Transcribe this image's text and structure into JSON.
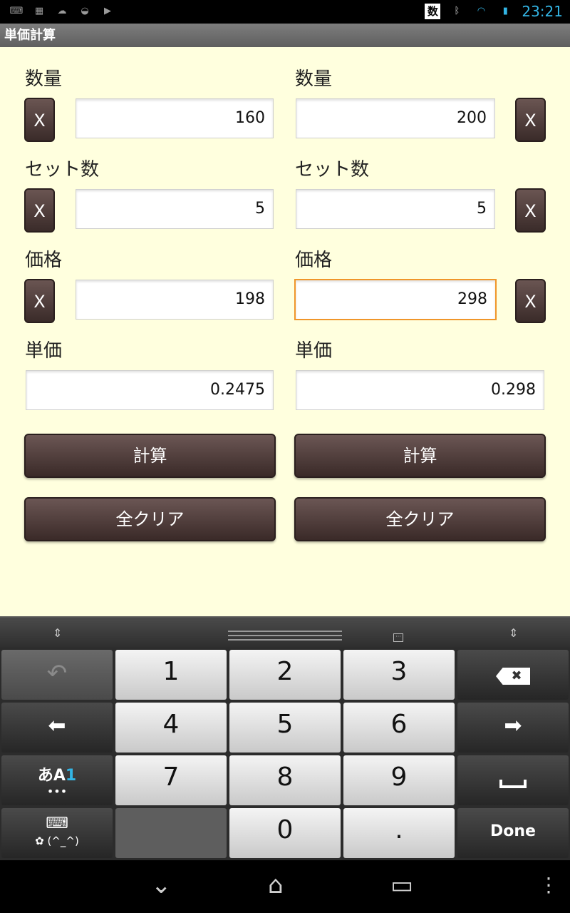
{
  "status_bar": {
    "left_icons": [
      "keyboard-icon",
      "photo-icon",
      "weather-icon",
      "android-icon",
      "play-store-icon"
    ],
    "ime_indicator": "数",
    "time": "23:21",
    "icons": [
      "bluetooth-icon",
      "wifi-icon",
      "battery-icon"
    ]
  },
  "app": {
    "title": "単価計算"
  },
  "left": {
    "quantity_label": "数量",
    "quantity_value": "160",
    "set_label": "セット数",
    "set_value": "5",
    "price_label": "価格",
    "price_value": "198",
    "unit_price_label": "単価",
    "unit_price_value": "0.2475",
    "clear_x": "X",
    "calc_label": "計算",
    "clear_all_label": "全クリア"
  },
  "right": {
    "quantity_label": "数量",
    "quantity_value": "200",
    "set_label": "セット数",
    "set_value": "5",
    "price_label": "価格",
    "price_value": "298",
    "unit_price_label": "単価",
    "unit_price_value": "0.298",
    "clear_x": "X",
    "calc_label": "計算",
    "clear_all_label": "全クリア"
  },
  "keyboard": {
    "keys": [
      "1",
      "2",
      "3",
      "4",
      "5",
      "6",
      "7",
      "8",
      "9",
      "0",
      "."
    ],
    "done_label": "Done",
    "ime_mode_label": "あA",
    "ime_mode_digit": "1",
    "ime_dots": "•••",
    "emoticon_label": "(^_^)"
  },
  "colors": {
    "content_bg": "#ffffde",
    "button_brown": "#4a3836",
    "focus_orange": "#f0962a",
    "accent_blue": "#33b5e5"
  }
}
